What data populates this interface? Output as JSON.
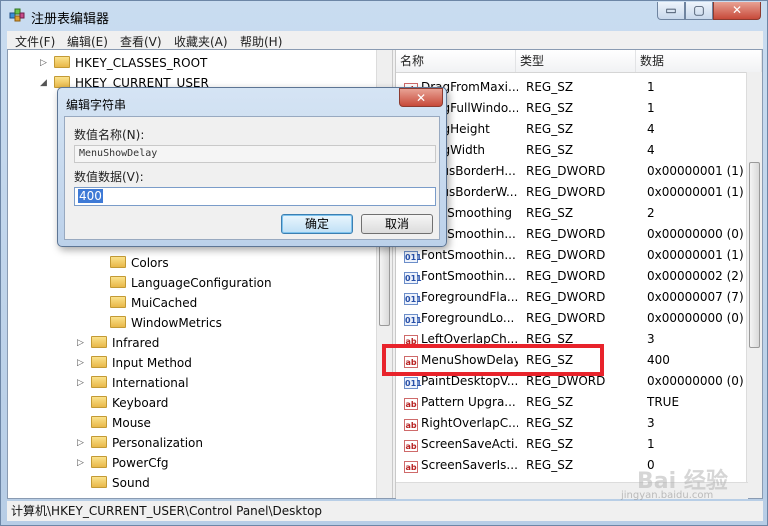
{
  "window": {
    "title": "注册表编辑器",
    "min_glyph": "▭",
    "max_glyph": "▢",
    "close_glyph": "✕"
  },
  "menu": [
    "文件(F)",
    "编辑(E)",
    "查看(V)",
    "收藏夹(A)",
    "帮助(H)"
  ],
  "tree": [
    {
      "label": "HKEY_CLASSES_ROOT",
      "arrow": "▷"
    },
    {
      "label": "HKEY_CURRENT_USER",
      "arrow": "◢"
    },
    {
      "label": "Colors",
      "arrow": ""
    },
    {
      "label": "LanguageConfiguration",
      "arrow": ""
    },
    {
      "label": "MuiCached",
      "arrow": ""
    },
    {
      "label": "WindowMetrics",
      "arrow": ""
    },
    {
      "label": "Infrared",
      "arrow": "▷"
    },
    {
      "label": "Input Method",
      "arrow": "▷"
    },
    {
      "label": "International",
      "arrow": "▷"
    },
    {
      "label": "Keyboard",
      "arrow": ""
    },
    {
      "label": "Mouse",
      "arrow": ""
    },
    {
      "label": "Personalization",
      "arrow": "▷"
    },
    {
      "label": "PowerCfg",
      "arrow": "▷"
    },
    {
      "label": "Sound",
      "arrow": ""
    }
  ],
  "columns": [
    "名称",
    "类型",
    "数据"
  ],
  "values": [
    {
      "name": "DragFromMaxi...",
      "type": "REG_SZ",
      "data": "1",
      "icon": "ab"
    },
    {
      "name": "DragFullWindo...",
      "type": "REG_SZ",
      "data": "1",
      "icon": "ab"
    },
    {
      "name": "DragHeight",
      "type": "REG_SZ",
      "data": "4",
      "icon": "ab"
    },
    {
      "name": "DragWidth",
      "type": "REG_SZ",
      "data": "4",
      "icon": "ab"
    },
    {
      "name": "FocusBorderH...",
      "type": "REG_DWORD",
      "data": "0x00000001 (1)",
      "icon": "011"
    },
    {
      "name": "FocusBorderW...",
      "type": "REG_DWORD",
      "data": "0x00000001 (1)",
      "icon": "011"
    },
    {
      "name": "FontSmoothing",
      "type": "REG_SZ",
      "data": "2",
      "icon": "ab"
    },
    {
      "name": "FontSmoothin...",
      "type": "REG_DWORD",
      "data": "0x00000000 (0)",
      "icon": "011"
    },
    {
      "name": "FontSmoothin...",
      "type": "REG_DWORD",
      "data": "0x00000001 (1)",
      "icon": "011"
    },
    {
      "name": "FontSmoothin...",
      "type": "REG_DWORD",
      "data": "0x00000002 (2)",
      "icon": "011"
    },
    {
      "name": "ForegroundFla...",
      "type": "REG_DWORD",
      "data": "0x00000007 (7)",
      "icon": "011"
    },
    {
      "name": "ForegroundLo...",
      "type": "REG_DWORD",
      "data": "0x00000000 (0)",
      "icon": "011"
    },
    {
      "name": "LeftOverlapCh...",
      "type": "REG_SZ",
      "data": "3",
      "icon": "ab"
    },
    {
      "name": "MenuShowDelay",
      "type": "REG_SZ",
      "data": "400",
      "icon": "ab"
    },
    {
      "name": "PaintDesktopV...",
      "type": "REG_DWORD",
      "data": "0x00000000 (0)",
      "icon": "011"
    },
    {
      "name": "Pattern Upgra...",
      "type": "REG_SZ",
      "data": "TRUE",
      "icon": "ab"
    },
    {
      "name": "RightOverlapC...",
      "type": "REG_SZ",
      "data": "3",
      "icon": "ab"
    },
    {
      "name": "ScreenSaveActi...",
      "type": "REG_SZ",
      "data": "1",
      "icon": "ab"
    },
    {
      "name": "ScreenSaverIs...",
      "type": "REG_SZ",
      "data": "0",
      "icon": "ab"
    }
  ],
  "status": "计算机\\HKEY_CURRENT_USER\\Control Panel\\Desktop",
  "dialog": {
    "title": "编辑字符串",
    "close_glyph": "✕",
    "name_label": "数值名称(N):",
    "name_value": "MenuShowDelay",
    "data_label": "数值数据(V):",
    "data_value": "400",
    "ok_label": "确定",
    "cancel_label": "取消"
  },
  "watermark": {
    "text": "Bai 经验",
    "url": "jingyan.baidu.com"
  },
  "colors": {
    "highlight": "#e8232b",
    "selection": "#3e7ad6"
  }
}
